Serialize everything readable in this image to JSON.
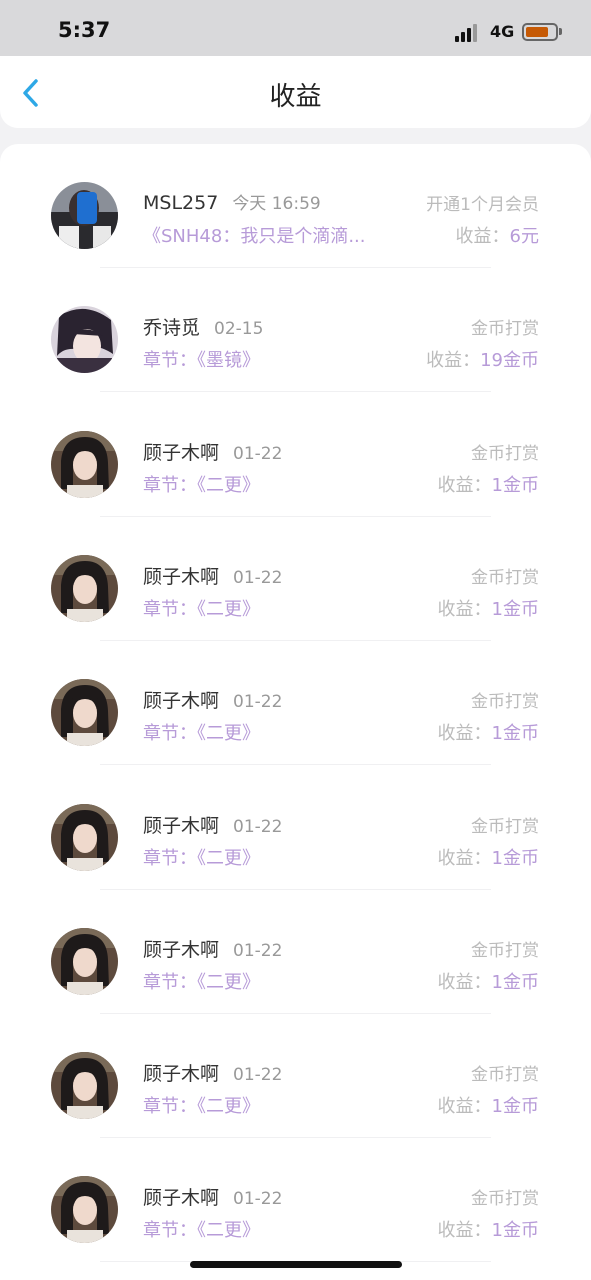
{
  "status_bar": {
    "time": "5:37",
    "network": "4G",
    "battery_color": "#c65a05"
  },
  "nav": {
    "back_icon": "chevron-left-icon",
    "title": "收益",
    "accent_color": "#2ea8e6"
  },
  "rows": [
    {
      "name": "MSL257",
      "time": "今天 16:59",
      "type": "开通1个月会员",
      "chapter": "《SNH48：我只是个滴滴...",
      "income_label": "收益：",
      "income_value": "6元",
      "avatar": "avatar-phone-selfie"
    },
    {
      "name": "乔诗觅",
      "time": "02-15",
      "type": "金币打赏",
      "chapter": "章节：《墨镜》",
      "income_label": "收益：",
      "income_value": "19金币",
      "avatar": "avatar-anime"
    },
    {
      "name": "顾子木啊",
      "time": "01-22",
      "type": "金币打赏",
      "chapter": "章节：《二更》",
      "income_label": "收益：",
      "income_value": "1金币",
      "avatar": "avatar-girl"
    },
    {
      "name": "顾子木啊",
      "time": "01-22",
      "type": "金币打赏",
      "chapter": "章节：《二更》",
      "income_label": "收益：",
      "income_value": "1金币",
      "avatar": "avatar-girl"
    },
    {
      "name": "顾子木啊",
      "time": "01-22",
      "type": "金币打赏",
      "chapter": "章节：《二更》",
      "income_label": "收益：",
      "income_value": "1金币",
      "avatar": "avatar-girl"
    },
    {
      "name": "顾子木啊",
      "time": "01-22",
      "type": "金币打赏",
      "chapter": "章节：《二更》",
      "income_label": "收益：",
      "income_value": "1金币",
      "avatar": "avatar-girl"
    },
    {
      "name": "顾子木啊",
      "time": "01-22",
      "type": "金币打赏",
      "chapter": "章节：《二更》",
      "income_label": "收益：",
      "income_value": "1金币",
      "avatar": "avatar-girl"
    },
    {
      "name": "顾子木啊",
      "time": "01-22",
      "type": "金币打赏",
      "chapter": "章节：《二更》",
      "income_label": "收益：",
      "income_value": "1金币",
      "avatar": "avatar-girl"
    },
    {
      "name": "顾子木啊",
      "time": "01-22",
      "type": "金币打赏",
      "chapter": "章节：《二更》",
      "income_label": "收益：",
      "income_value": "1金币",
      "avatar": "avatar-girl"
    }
  ]
}
